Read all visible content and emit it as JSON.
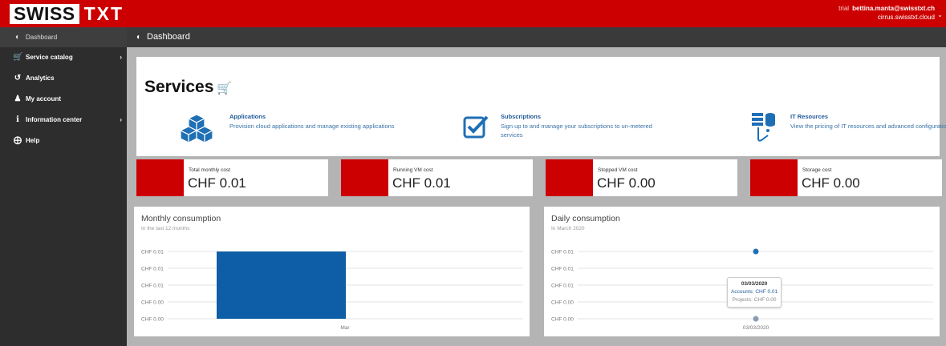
{
  "brand": {
    "swiss": "SWISS",
    "txt": "TXT"
  },
  "user": {
    "trial": "trial",
    "email": "bettina.manta@swisstxt.ch",
    "host": "cirrus.swisstxt.cloud"
  },
  "header": {
    "title": "Dashboard"
  },
  "sidebar": {
    "items": [
      {
        "label": "Dashboard",
        "icon": "dashboard-icon"
      },
      {
        "label": "Service catalog",
        "icon": "cart-icon"
      },
      {
        "label": "Analytics",
        "icon": "analytics-icon"
      },
      {
        "label": "My account",
        "icon": "user-icon"
      },
      {
        "label": "Information center",
        "icon": "info-icon"
      },
      {
        "label": "Help",
        "icon": "help-icon"
      }
    ]
  },
  "services": {
    "title": "Services",
    "items": [
      {
        "name": "Applications",
        "desc": "Provision cloud applications and manage existing applications",
        "icon": "cubes-icon"
      },
      {
        "name": "Subscriptions",
        "desc": "Sign up to and manage your subscriptions to un-metered services",
        "icon": "checkbox-icon"
      },
      {
        "name": "IT Resources",
        "desc": "View the pricing of IT resources and advanced configurations",
        "icon": "server-icon"
      }
    ]
  },
  "costs": [
    {
      "label": "Total monthly cost",
      "value": "CHF 0.01"
    },
    {
      "label": "Running VM cost",
      "value": "CHF 0.01"
    },
    {
      "label": "Stopped VM cost",
      "value": "CHF 0.00"
    },
    {
      "label": "Storage cost",
      "value": "CHF 0.00"
    }
  ],
  "colors": {
    "brand_red": "#cc0000",
    "bar_blue": "#0d5ea6",
    "link_blue": "#1f5a96"
  },
  "chart_data": [
    {
      "type": "bar",
      "title": "Monthly consumption",
      "subtitle": "In the last 12 months",
      "categories": [
        "Mar"
      ],
      "values": [
        0.01
      ],
      "yticks": [
        "CHF 0.01",
        "CHF 0.01",
        "CHF 0.01",
        "CHF 0.00",
        "CHF 0.00"
      ],
      "ylim": [
        0,
        0.01
      ]
    },
    {
      "type": "scatter",
      "title": "Daily consumption",
      "subtitle": "In March 2020",
      "categories": [
        "03/03/2020"
      ],
      "series": [
        {
          "name": "Accounts",
          "values": [
            0.01
          ]
        },
        {
          "name": "Projects",
          "values": [
            0.0
          ]
        }
      ],
      "yticks": [
        "CHF 0.01",
        "CHF 0.01",
        "CHF 0.01",
        "CHF 0.00",
        "CHF 0.00"
      ],
      "ylim": [
        0,
        0.01
      ],
      "tooltip": {
        "date": "03/03/2020",
        "accounts": "Accounts: CHF 0.01",
        "projects": "Projects: CHF 0.00"
      }
    }
  ]
}
